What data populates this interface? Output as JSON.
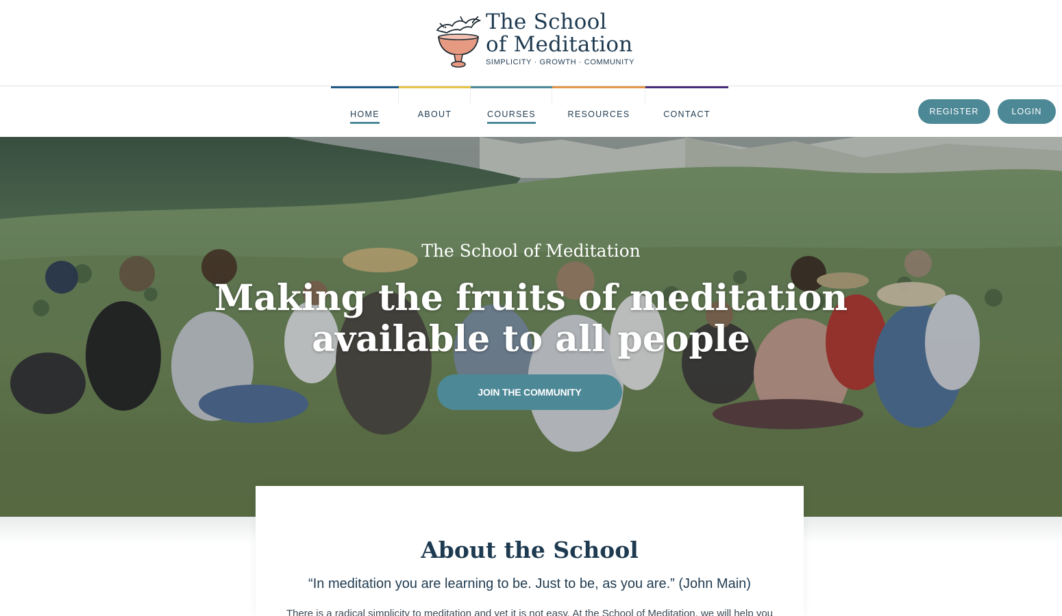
{
  "logo": {
    "line1": "The School",
    "line2": "of Meditation",
    "tagline": "SIMPLICITY · GROWTH · COMMUNITY"
  },
  "nav": {
    "items": [
      {
        "label": "HOME",
        "accent": "#1f5a86",
        "active": true
      },
      {
        "label": "ABOUT",
        "accent": "#e6c547",
        "active": false
      },
      {
        "label": "COURSES",
        "accent": "#4b8a96",
        "active": true
      },
      {
        "label": "RESOURCES",
        "accent": "#e3954a",
        "active": false
      },
      {
        "label": "CONTACT",
        "accent": "#4a2d7a",
        "active": false
      }
    ]
  },
  "auth": {
    "register_label": "REGISTER",
    "login_label": "LOGIN"
  },
  "hero": {
    "kicker": "The School of Meditation",
    "title": "Making the fruits of meditation available to all people",
    "cta_label": "JOIN THE COMMUNITY"
  },
  "about": {
    "title": "About the School",
    "quote": "“In meditation you are learning to be. Just to be, as you are.” (John Main)",
    "body": "There is a radical simplicity to meditation and yet it is not easy. At the School of Meditation, we will help you"
  },
  "colors": {
    "brand": "#1e3a50",
    "button": "#4d8896"
  }
}
